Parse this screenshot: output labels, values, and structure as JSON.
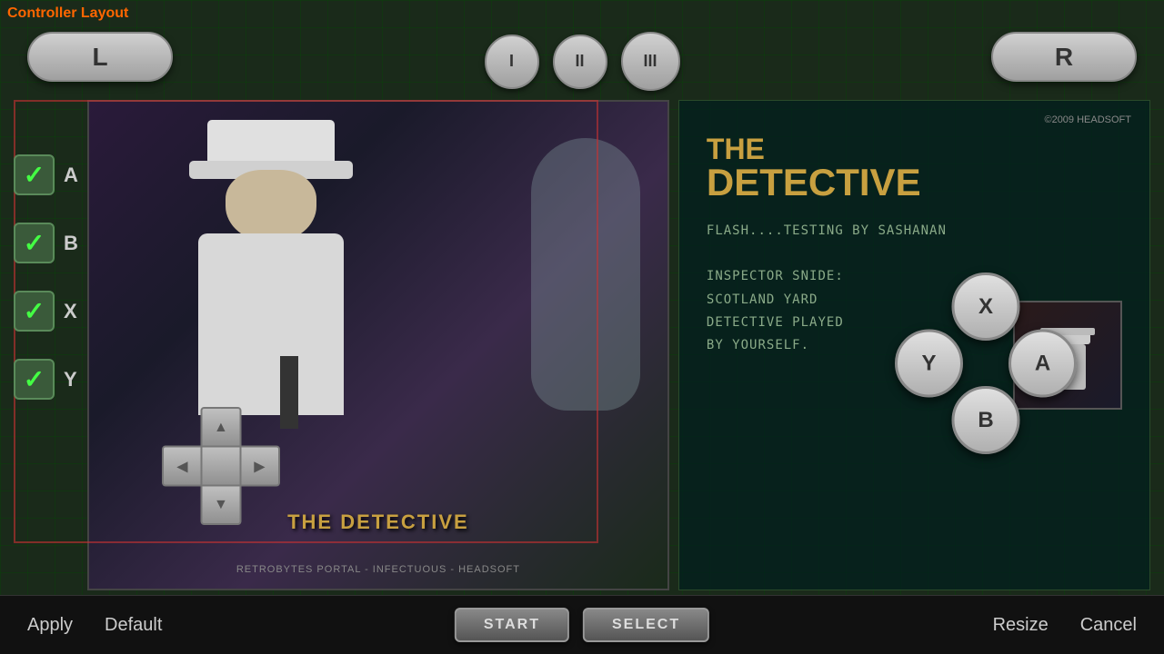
{
  "title": "Controller Layout",
  "shoulder_buttons": {
    "left": "L",
    "right": "R"
  },
  "center_buttons": {
    "btn1": "I",
    "btn2": "II",
    "btn3": "III"
  },
  "checkboxes": [
    {
      "label": "A",
      "checked": true
    },
    {
      "label": "B",
      "checked": true
    },
    {
      "label": "X",
      "checked": true
    },
    {
      "label": "Y",
      "checked": true
    }
  ],
  "game": {
    "title_overlay": "THE DETECTIVE",
    "footer_text": "RETROBYTES PORTAL - INFECTUOUS - HEADSOFT",
    "copyright": "©2009 HEADSOFT",
    "info_title_line1": "THE",
    "info_title_line2": "DETECTIVE",
    "flash_text": "FLASH....TESTING BY SASHANAN",
    "inspector_label": "INSPECTOR SNIDE:",
    "description_line1": "SCOTLAND YARD",
    "description_line2": "DETECTIVE PLAYED",
    "description_line3": "BY YOURSELF."
  },
  "action_buttons": {
    "x": "X",
    "y": "Y",
    "a": "A",
    "b": "B"
  },
  "bottom_bar": {
    "apply": "Apply",
    "default": "Default",
    "start": "START",
    "select": "SELECT",
    "resize": "Resize",
    "cancel": "Cancel"
  }
}
